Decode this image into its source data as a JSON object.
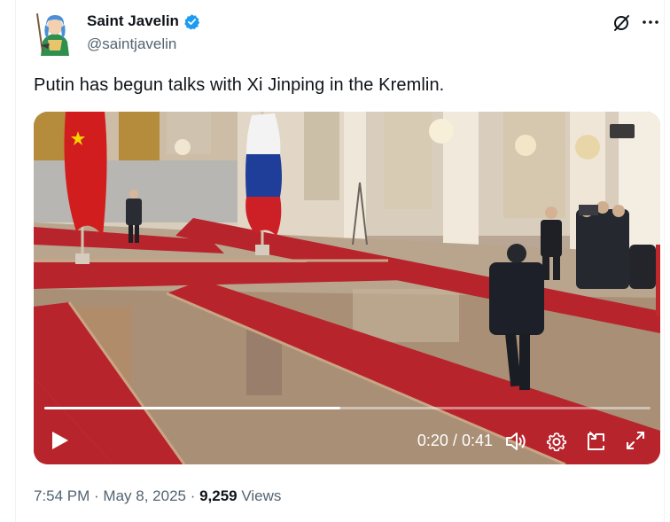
{
  "tweet": {
    "author": {
      "display_name": "Saint Javelin",
      "handle": "@saintjavelin",
      "verified": true
    },
    "text": "Putin has begun talks with Xi Jinping in the Kremlin.",
    "media": {
      "type": "video",
      "current_time": "0:20",
      "time_separator": "/",
      "duration": "0:41",
      "progress_fraction": 0.488
    },
    "meta": {
      "time": "7:54 PM",
      "separator": " · ",
      "date": "May 8, 2025",
      "views_count": "9,259",
      "views_label": "Views"
    }
  },
  "icons": {
    "verified": "verified-badge-icon",
    "grok": "grok-icon",
    "more": "more-options-icon",
    "play": "play-icon",
    "volume": "volume-icon",
    "settings": "settings-gear-icon",
    "dock": "dock-icon",
    "fullscreen": "fullscreen-icon"
  },
  "colors": {
    "verified_blue": "#1d9bf0",
    "text_primary": "#0f1419",
    "text_secondary": "#536471",
    "carpet_red": "#b8242c"
  }
}
